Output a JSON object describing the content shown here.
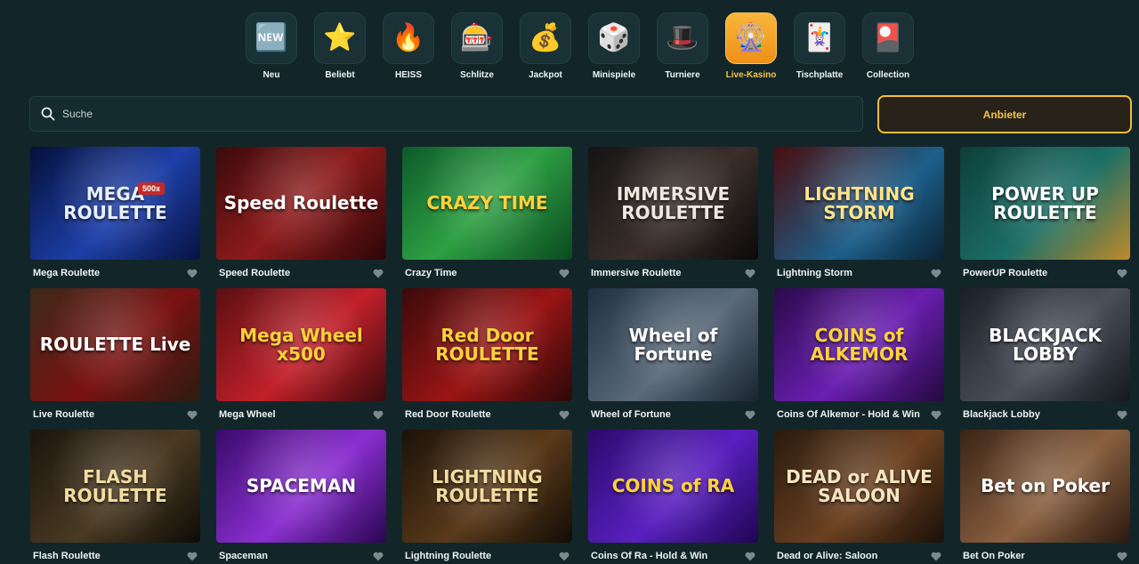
{
  "categories": [
    {
      "label": "Neu",
      "icon": "new-badge-icon",
      "glyph": "🆕",
      "active": false
    },
    {
      "label": "Beliebt",
      "icon": "star-icon",
      "glyph": "⭐",
      "active": false
    },
    {
      "label": "HEISS",
      "icon": "fire-icon",
      "glyph": "🔥",
      "active": false
    },
    {
      "label": "Schlitze",
      "icon": "slot-machine-icon",
      "glyph": "🎰",
      "active": false
    },
    {
      "label": "Jackpot",
      "icon": "money-bag-icon",
      "glyph": "💰",
      "active": false
    },
    {
      "label": "Minispiele",
      "icon": "dice-icon",
      "glyph": "🎲",
      "active": false
    },
    {
      "label": "Turniere",
      "icon": "top-hat-icon",
      "glyph": "🎩",
      "active": false
    },
    {
      "label": "Live-Kasino",
      "icon": "roulette-wheel-icon",
      "glyph": "🎡",
      "active": true
    },
    {
      "label": "Tischplatte",
      "icon": "playing-cards-icon",
      "glyph": "🃏",
      "active": false
    },
    {
      "label": "Collection",
      "icon": "collection-icon",
      "glyph": "🎴",
      "active": false
    }
  ],
  "search": {
    "placeholder": "Suche"
  },
  "provider_button": {
    "label": "Anbieter"
  },
  "games": [
    {
      "name": "Mega Roulette",
      "art": "MEGA ROULETTE",
      "badge": "500x",
      "bg": "linear-gradient(135deg,#05103a,#1d3fa8 55%,#07123f)",
      "fg": "#e8f0ff"
    },
    {
      "name": "Speed Roulette",
      "art": "Speed Roulette",
      "badge": "",
      "bg": "linear-gradient(135deg,#3a0a0c,#8e1b1b 50%,#2b0608)",
      "fg": "#ffffff"
    },
    {
      "name": "Crazy Time",
      "art": "CRAZY TIME",
      "badge": "",
      "bg": "linear-gradient(135deg,#0d5a2a,#2ea043 50%,#0b4a20)",
      "fg": "#ffd23a"
    },
    {
      "name": "Immersive Roulette",
      "art": "IMMERSIVE ROULETTE",
      "badge": "",
      "bg": "linear-gradient(135deg,#141414,#3a2e2a 55%,#0a0a0a)",
      "fg": "#f0e8e0"
    },
    {
      "name": "Lightning Storm",
      "art": "LIGHTNING STORM",
      "badge": "",
      "bg": "linear-gradient(135deg,#4a0d0d,#1d5f8a 60%,#0a2233)",
      "fg": "#ffe38a"
    },
    {
      "name": "PowerUP Roulette",
      "art": "POWER UP ROULETTE",
      "badge": "",
      "bg": "linear-gradient(135deg,#0e3e3a,#1b6f66 55%,#c08a2a)",
      "fg": "#ffffff"
    },
    {
      "name": "Live Roulette",
      "art": "ROULETTE Live",
      "badge": "",
      "bg": "linear-gradient(135deg,#3b2a1a,#7a1212 55%,#2a1c10)",
      "fg": "#ffffff"
    },
    {
      "name": "Mega Wheel",
      "art": "Mega Wheel x500",
      "badge": "",
      "bg": "linear-gradient(135deg,#5a0f12,#c2202a 55%,#3a0a0c)",
      "fg": "#ffd23a"
    },
    {
      "name": "Red Door Roulette",
      "art": "Red Door ROULETTE",
      "badge": "",
      "bg": "linear-gradient(135deg,#3a0a0a,#9b1515 55%,#2a0808)",
      "fg": "#ffd23a"
    },
    {
      "name": "Wheel of Fortune",
      "art": "Wheel of Fortune",
      "badge": "",
      "bg": "linear-gradient(135deg,#1e3040,#5a6a7a 55%,#1a2430)",
      "fg": "#ffffff"
    },
    {
      "name": "Coins Of Alkemor - Hold & Win",
      "art": "COINS of ALKEMOR",
      "badge": "",
      "bg": "linear-gradient(135deg,#2a0a4a,#6a1fb0 55%,#24083f)",
      "fg": "#ffd23a"
    },
    {
      "name": "Blackjack Lobby",
      "art": "BLACKJACK LOBBY",
      "badge": "",
      "bg": "linear-gradient(135deg,#1a1e26,#4a505a 55%,#14181e)",
      "fg": "#ffffff"
    },
    {
      "name": "Flash Roulette",
      "art": "FLASH ROULETTE",
      "badge": "",
      "bg": "linear-gradient(135deg,#1a140c,#4a3a22 55%,#0e0b06)",
      "fg": "#f3dca0"
    },
    {
      "name": "Spaceman",
      "art": "SPACEMAN",
      "badge": "",
      "bg": "linear-gradient(135deg,#3a0a6a,#8a2fd0 55%,#2a0650)",
      "fg": "#ffffff"
    },
    {
      "name": "Lightning Roulette",
      "art": "LIGHTNING ROULETTE",
      "badge": "",
      "bg": "linear-gradient(135deg,#1a1208,#5a3a1a 55%,#120c05)",
      "fg": "#f3dca0"
    },
    {
      "name": "Coins Of Ra - Hold & Win",
      "art": "COINS of RA",
      "badge": "",
      "bg": "linear-gradient(135deg,#2a0a6a,#5a1fc0 55%,#1e0650)",
      "fg": "#ffd23a"
    },
    {
      "name": "Dead or Alive: Saloon",
      "art": "DEAD or ALIVE SALOON",
      "badge": "",
      "bg": "linear-gradient(135deg,#2a1a0e,#6a4020 55%,#1a1008)",
      "fg": "#f6e6c0"
    },
    {
      "name": "Bet On Poker",
      "art": "Bet on Poker",
      "badge": "",
      "bg": "linear-gradient(135deg,#3a2416,#8a6040 55%,#2a180e)",
      "fg": "#ffffff"
    }
  ]
}
